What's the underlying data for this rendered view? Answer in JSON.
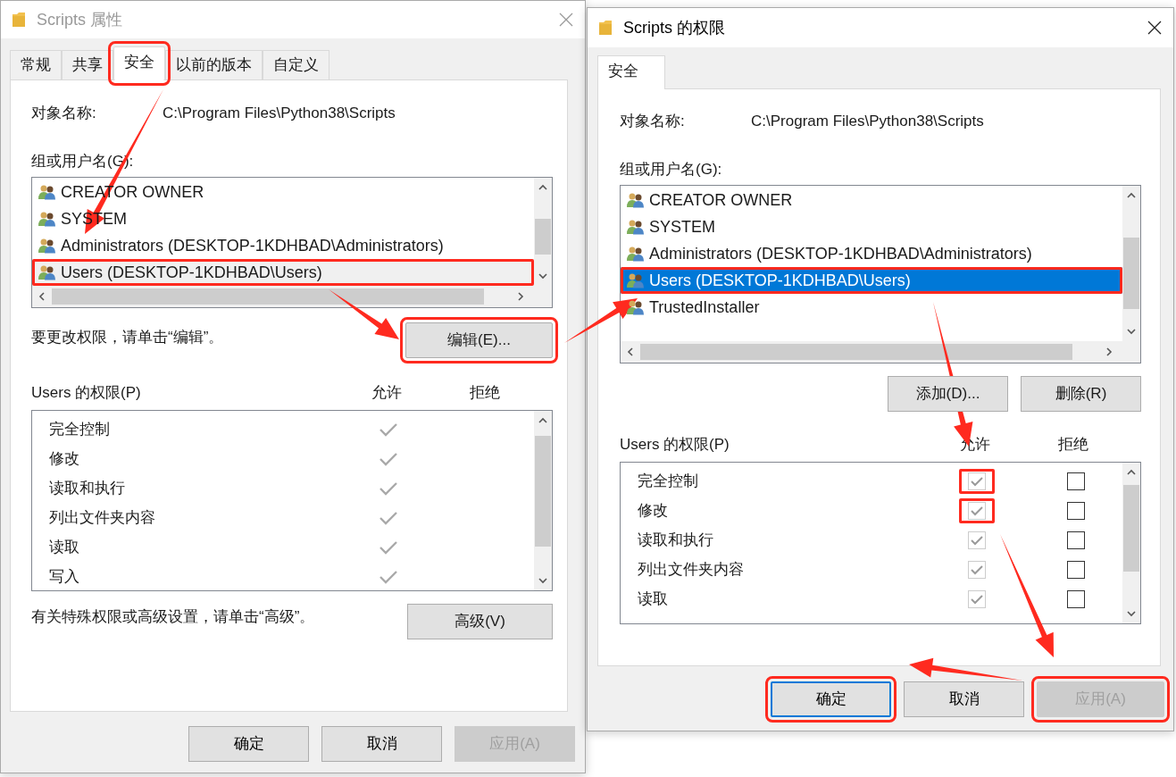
{
  "windows": [
    {
      "title": "Scripts 属性",
      "active": false,
      "tabs": [
        {
          "label": "常规",
          "selected": false,
          "highlighted": false
        },
        {
          "label": "共享",
          "selected": false,
          "highlighted": false
        },
        {
          "label": "安全",
          "selected": true,
          "highlighted": true
        },
        {
          "label": "以前的版本",
          "selected": false,
          "highlighted": false
        },
        {
          "label": "自定义",
          "selected": false,
          "highlighted": false
        }
      ],
      "object_label": "对象名称:",
      "object_value": "C:\\Program Files\\Python38\\Scripts",
      "group_label": "组或用户名(G):",
      "groups": [
        {
          "name": "CREATOR OWNER",
          "selected": false,
          "highlighted": false
        },
        {
          "name": "SYSTEM",
          "selected": false,
          "highlighted": false
        },
        {
          "name": "Administrators (DESKTOP-1KDHBAD\\Administrators)",
          "selected": false,
          "highlighted": false
        },
        {
          "name": "Users (DESKTOP-1KDHBAD\\Users)",
          "selected": true,
          "highlighted": true
        }
      ],
      "edit_hint": "要更改权限，请单击“编辑”。",
      "group_buttons": [
        {
          "label": "编辑(E)...",
          "highlighted": true
        }
      ],
      "permissions_label": "Users 的权限(P)",
      "allow_label": "允许",
      "deny_label": "拒绝",
      "permissions_editable": false,
      "permissions": [
        {
          "name": "完全控制",
          "allow": true,
          "deny": false
        },
        {
          "name": "修改",
          "allow": true,
          "deny": false
        },
        {
          "name": "读取和执行",
          "allow": true,
          "deny": false
        },
        {
          "name": "列出文件夹内容",
          "allow": true,
          "deny": false
        },
        {
          "name": "读取",
          "allow": true,
          "deny": false
        },
        {
          "name": "写入",
          "allow": true,
          "deny": false
        }
      ],
      "advanced_hint": "有关特殊权限或高级设置，请单击“高级”。",
      "advanced_button": "高级(V)",
      "buttons": [
        {
          "label": "确定",
          "default": false,
          "disabled": false,
          "highlighted": false
        },
        {
          "label": "取消",
          "default": false,
          "disabled": false,
          "highlighted": false
        },
        {
          "label": "应用(A)",
          "default": false,
          "disabled": true,
          "highlighted": false
        }
      ]
    },
    {
      "title": "Scripts 的权限",
      "active": true,
      "tabs": [
        {
          "label": "安全",
          "selected": true,
          "highlighted": false
        }
      ],
      "object_label": "对象名称:",
      "object_value": "C:\\Program Files\\Python38\\Scripts",
      "group_label": "组或用户名(G):",
      "groups": [
        {
          "name": "CREATOR OWNER",
          "selected": false,
          "highlighted": false
        },
        {
          "name": "SYSTEM",
          "selected": false,
          "highlighted": false
        },
        {
          "name": "Administrators (DESKTOP-1KDHBAD\\Administrators)",
          "selected": false,
          "highlighted": false
        },
        {
          "name": "Users (DESKTOP-1KDHBAD\\Users)",
          "selected": true,
          "highlighted": true
        },
        {
          "name": "TrustedInstaller",
          "selected": false,
          "highlighted": false
        }
      ],
      "group_buttons": [
        {
          "label": "添加(D)...",
          "highlighted": false
        },
        {
          "label": "删除(R)",
          "highlighted": false
        }
      ],
      "permissions_label": "Users 的权限(P)",
      "allow_label": "允许",
      "deny_label": "拒绝",
      "permissions_editable": true,
      "permissions": [
        {
          "name": "完全控制",
          "allow": true,
          "deny": false,
          "highlighted": true
        },
        {
          "name": "修改",
          "allow": true,
          "deny": false,
          "highlighted": true
        },
        {
          "name": "读取和执行",
          "allow": true,
          "deny": false,
          "highlighted": false
        },
        {
          "name": "列出文件夹内容",
          "allow": true,
          "deny": false,
          "highlighted": false
        },
        {
          "name": "读取",
          "allow": true,
          "deny": false,
          "highlighted": false
        }
      ],
      "buttons": [
        {
          "label": "确定",
          "default": true,
          "disabled": false,
          "highlighted": true
        },
        {
          "label": "取消",
          "default": false,
          "disabled": false,
          "highlighted": false
        },
        {
          "label": "应用(A)",
          "default": false,
          "disabled": true,
          "highlighted": true
        }
      ]
    }
  ]
}
